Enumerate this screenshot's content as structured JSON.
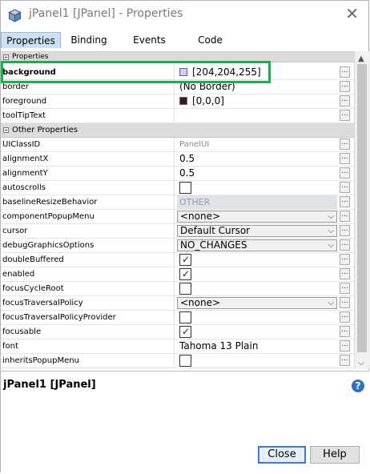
{
  "window": {
    "title": "jPanel1 [JPanel] - Properties",
    "close_glyph": "✕"
  },
  "tabs": [
    "Properties",
    "Binding",
    "Events",
    "Code"
  ],
  "categories": {
    "properties": "Properties",
    "other": "Other Properties"
  },
  "properties": [
    {
      "name": "background",
      "value": "[204,204,255]",
      "color": "#ccccff"
    },
    {
      "name": "border",
      "value": "(No Border)"
    },
    {
      "name": "foreground",
      "value": "[0,0,0]",
      "color": "#3a1a20"
    },
    {
      "name": "toolTipText",
      "value": ""
    }
  ],
  "other_properties": [
    {
      "name": "UIClassID",
      "value": "PanelUI"
    },
    {
      "name": "alignmentX",
      "value": "0.5"
    },
    {
      "name": "alignmentY",
      "value": "0.5"
    },
    {
      "name": "autoscrolls",
      "checked": false
    },
    {
      "name": "baselineResizeBehavior",
      "value": "OTHER"
    },
    {
      "name": "componentPopupMenu",
      "value": "<none>"
    },
    {
      "name": "cursor",
      "value": "Default Cursor"
    },
    {
      "name": "debugGraphicsOptions",
      "value": "NO_CHANGES"
    },
    {
      "name": "doubleBuffered",
      "checked": true
    },
    {
      "name": "enabled",
      "checked": true
    },
    {
      "name": "focusCycleRoot",
      "checked": false
    },
    {
      "name": "focusTraversalPolicy",
      "value": "<none>"
    },
    {
      "name": "focusTraversalPolicyProvider",
      "checked": false
    },
    {
      "name": "focusable",
      "checked": true
    },
    {
      "name": "font",
      "value": "Tahoma 13 Plain"
    },
    {
      "name": "inheritsPopupMenu",
      "checked": false
    }
  ],
  "ellipsis": "...",
  "description": {
    "title": "jPanel1 [JPanel]"
  },
  "buttons": {
    "close": "Close",
    "help": "Help"
  },
  "colors": {
    "highlight": "#1fab53",
    "active_tab": "#cce0f4"
  }
}
